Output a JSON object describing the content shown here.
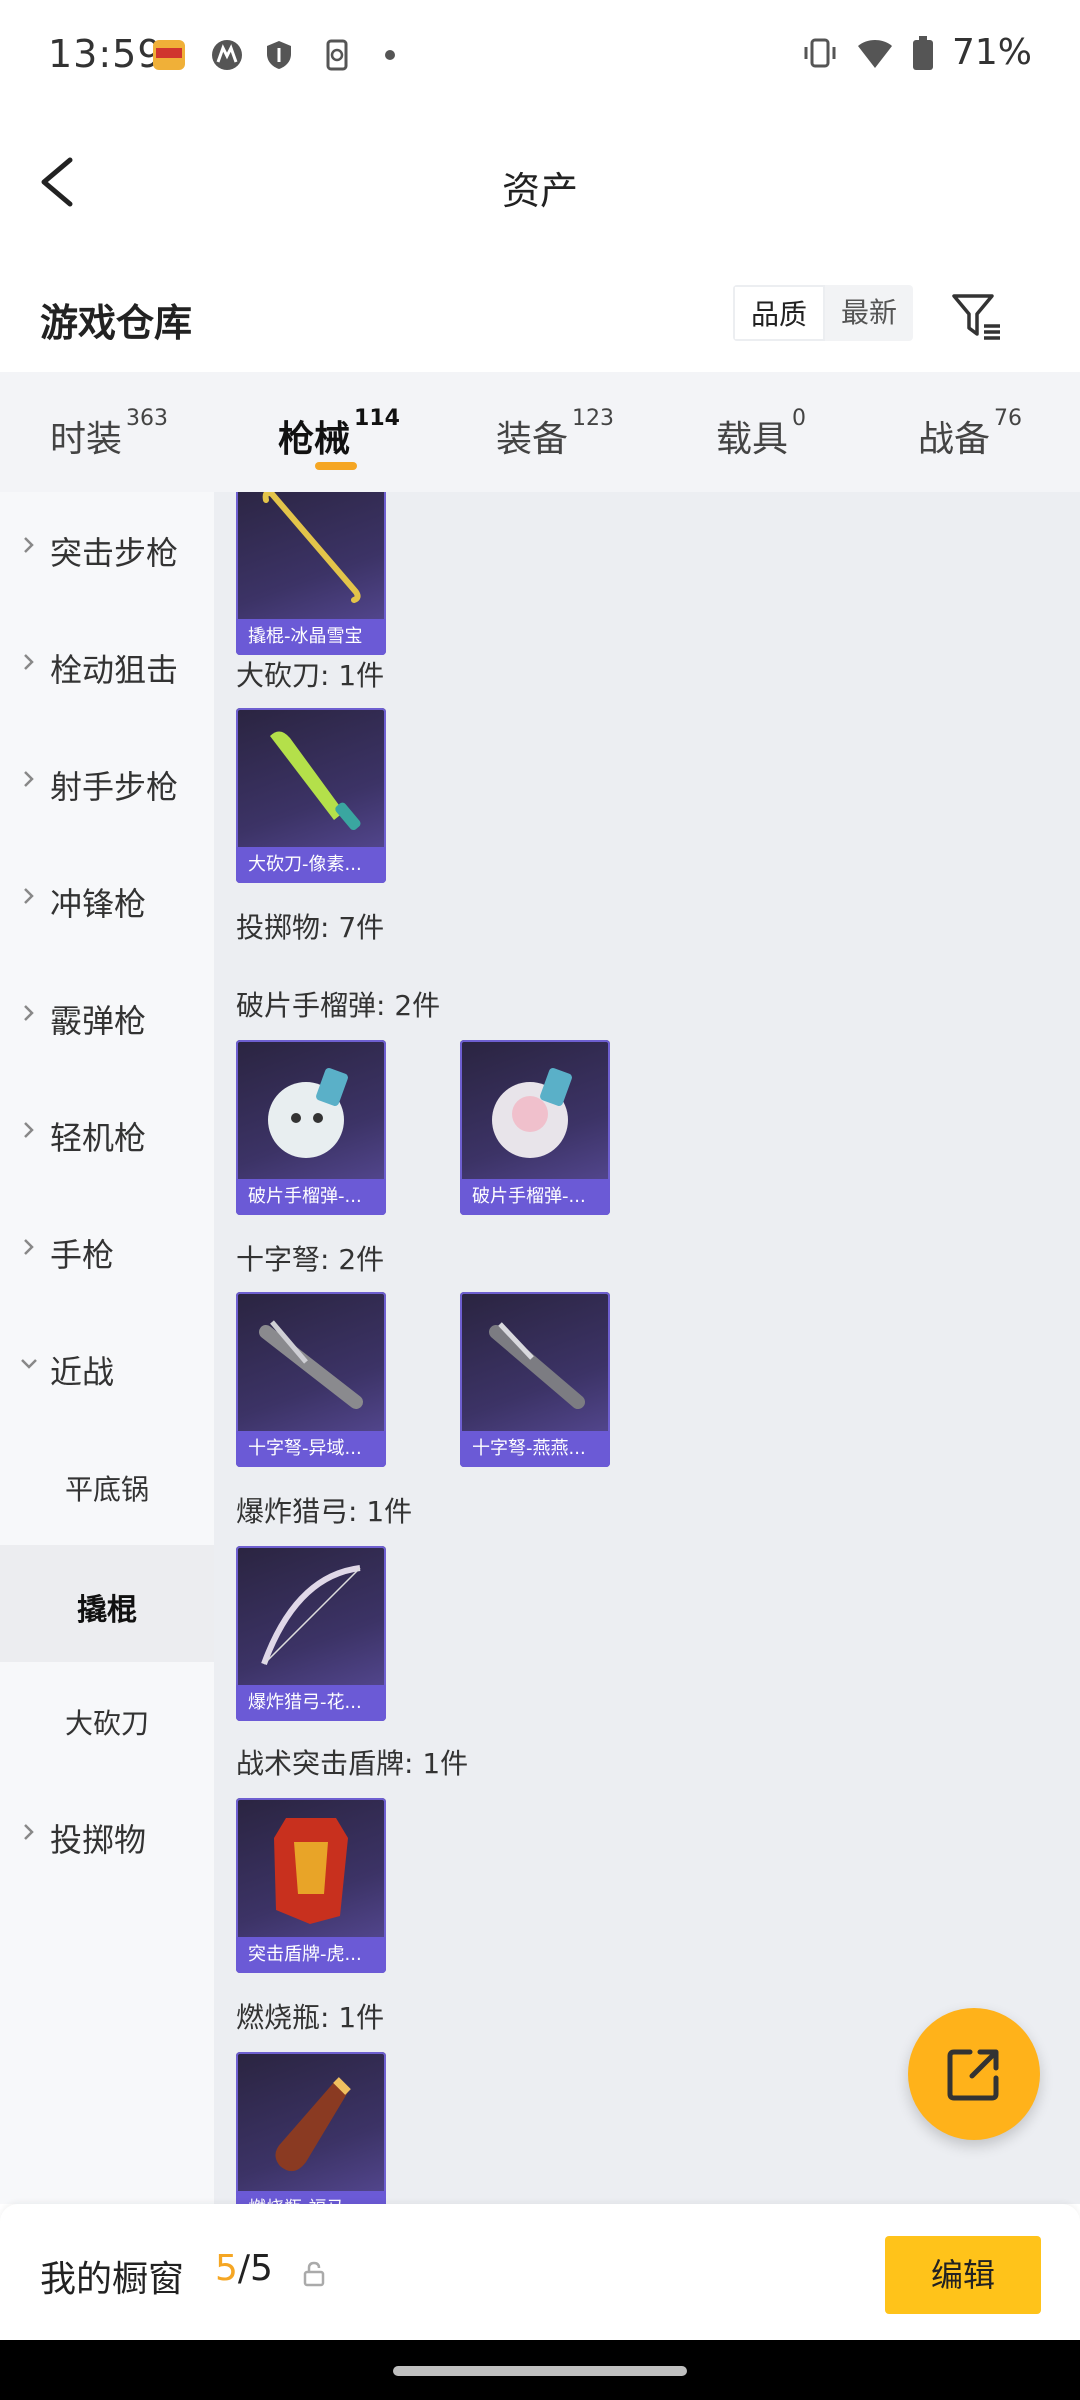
{
  "status_bar": {
    "time": "13:59",
    "battery": "71%"
  },
  "header": {
    "title": "资产"
  },
  "section": {
    "title": "游戏仓库",
    "sort_options": [
      "品质",
      "最新"
    ],
    "active_sort": "品质"
  },
  "tabs": [
    {
      "label": "时装",
      "count": "363"
    },
    {
      "label": "枪械",
      "count": "114"
    },
    {
      "label": "装备",
      "count": "123"
    },
    {
      "label": "载具",
      "count": "0"
    },
    {
      "label": "战备",
      "count": "76"
    }
  ],
  "active_tab": "枪械",
  "sidebar": {
    "items": [
      {
        "label": "突击步枪"
      },
      {
        "label": "栓动狙击"
      },
      {
        "label": "射手步枪"
      },
      {
        "label": "冲锋枪"
      },
      {
        "label": "霰弹枪"
      },
      {
        "label": "轻机枪"
      },
      {
        "label": "手枪"
      },
      {
        "label": "近战"
      },
      {
        "label": "投掷物"
      }
    ],
    "sub_items": [
      {
        "label": "平底锅"
      },
      {
        "label": "撬棍"
      },
      {
        "label": "大砍刀"
      }
    ],
    "active_sub": "撬棍"
  },
  "content": {
    "groups": [
      {
        "label": "大砍刀: 1件"
      },
      {
        "label": "投掷物: 7件"
      },
      {
        "label": "破片手榴弹: 2件"
      },
      {
        "label": "十字弩: 2件"
      },
      {
        "label": "爆炸猎弓: 1件"
      },
      {
        "label": "战术突击盾牌: 1件"
      },
      {
        "label": "燃烧瓶: 1件"
      }
    ],
    "cards": [
      {
        "caption": "撬棍-冰晶雪宝"
      },
      {
        "caption": "大砍刀-像素..."
      },
      {
        "caption": "破片手榴弹-..."
      },
      {
        "caption": "破片手榴弹-..."
      },
      {
        "caption": "十字弩-异域..."
      },
      {
        "caption": "十字弩-燕燕..."
      },
      {
        "caption": "爆炸猎弓-花..."
      },
      {
        "caption": "突击盾牌-虎..."
      },
      {
        "caption": "燃烧瓶-福马..."
      }
    ]
  },
  "bottom_bar": {
    "label": "我的橱窗",
    "current": "5",
    "separator": "/",
    "total": "5",
    "edit_label": "编辑"
  },
  "colors": {
    "accent": "#f5a623",
    "button": "#ffc31a",
    "card_caption": "#6b5ad6"
  }
}
